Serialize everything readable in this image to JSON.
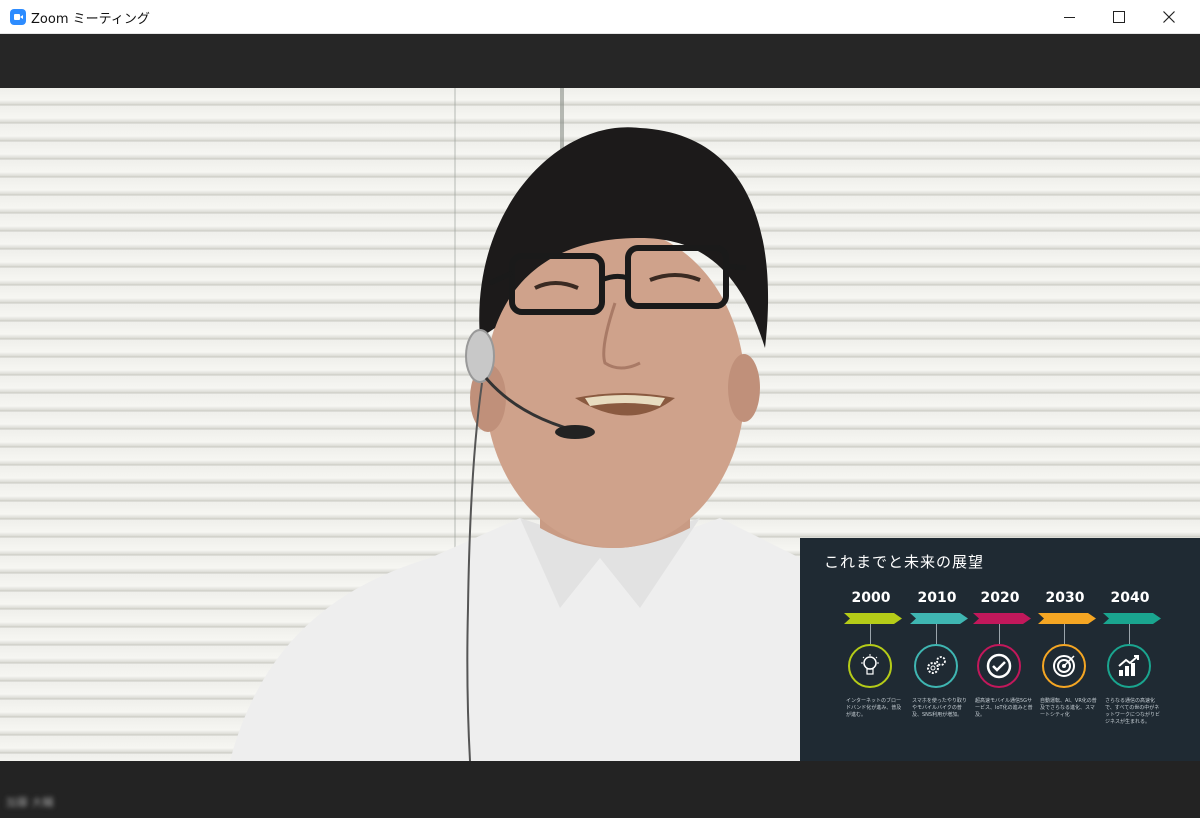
{
  "window": {
    "title": "Zoom ミーティング",
    "app_icon": "zoom-camera-icon",
    "controls": [
      "minimize-icon",
      "maximize-icon",
      "close-icon"
    ]
  },
  "colors": {
    "title_bar": "#ffffff",
    "meeting_background": "#232323",
    "zoom_blue": "#2d8cff",
    "slide_background": "#1f2a33"
  },
  "slide": {
    "title": "これまでと未来の展望",
    "milestones": [
      {
        "year": "2000",
        "color": "#b5cc18",
        "icon": "lightbulb-icon",
        "text": "インターネットのブロードバンド化が進み、普及が進む。"
      },
      {
        "year": "2010",
        "color": "#3fb6b2",
        "icon": "gears-icon",
        "text": "スマホを使ったやり取りやモバイルバイクの普及、SNS利用が増加。"
      },
      {
        "year": "2020",
        "color": "#c2185b",
        "icon": "checkmark-icon",
        "text": "超高速モバイル通信5Gサービス、IoT化の進みと普及。"
      },
      {
        "year": "2030",
        "color": "#f5a623",
        "icon": "target-icon",
        "text": "自動運転、AI、VR化の普及でさらなる進化、スマートシティ化"
      },
      {
        "year": "2040",
        "color": "#1aa58f",
        "icon": "growth-chart-icon",
        "text": "さらなる通信の高速化で、すべての世の中がネットワークにつながりビジネスが生まれる。"
      }
    ]
  },
  "participant": {
    "name": "加藤 大輔"
  }
}
